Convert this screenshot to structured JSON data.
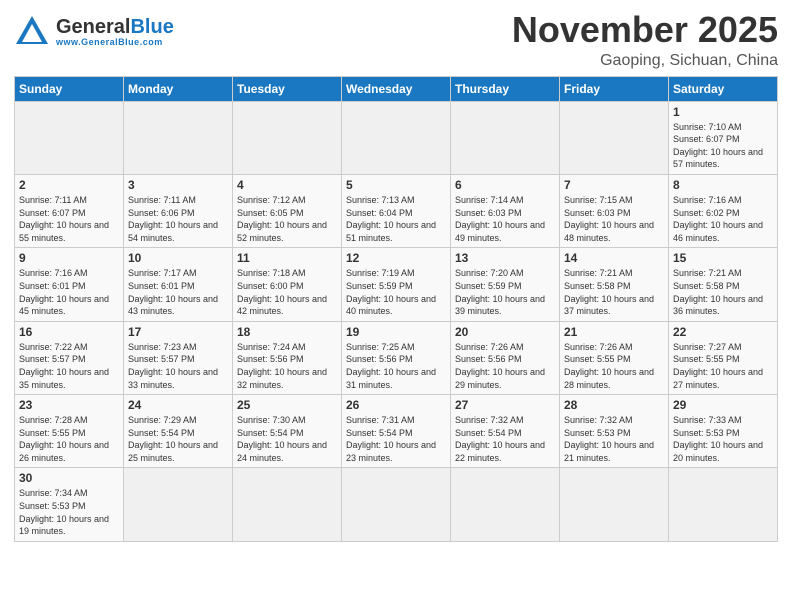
{
  "logo": {
    "word1": "General",
    "word2": "Blue"
  },
  "header": {
    "month": "November 2025",
    "location": "Gaoping, Sichuan, China"
  },
  "weekdays": [
    "Sunday",
    "Monday",
    "Tuesday",
    "Wednesday",
    "Thursday",
    "Friday",
    "Saturday"
  ],
  "weeks": [
    [
      {
        "day": "",
        "info": ""
      },
      {
        "day": "",
        "info": ""
      },
      {
        "day": "",
        "info": ""
      },
      {
        "day": "",
        "info": ""
      },
      {
        "day": "",
        "info": ""
      },
      {
        "day": "",
        "info": ""
      },
      {
        "day": "1",
        "info": "Sunrise: 7:10 AM\nSunset: 6:07 PM\nDaylight: 10 hours and 57 minutes."
      }
    ],
    [
      {
        "day": "2",
        "info": "Sunrise: 7:11 AM\nSunset: 6:07 PM\nDaylight: 10 hours and 55 minutes."
      },
      {
        "day": "3",
        "info": "Sunrise: 7:11 AM\nSunset: 6:06 PM\nDaylight: 10 hours and 54 minutes."
      },
      {
        "day": "4",
        "info": "Sunrise: 7:12 AM\nSunset: 6:05 PM\nDaylight: 10 hours and 52 minutes."
      },
      {
        "day": "5",
        "info": "Sunrise: 7:13 AM\nSunset: 6:04 PM\nDaylight: 10 hours and 51 minutes."
      },
      {
        "day": "6",
        "info": "Sunrise: 7:14 AM\nSunset: 6:03 PM\nDaylight: 10 hours and 49 minutes."
      },
      {
        "day": "7",
        "info": "Sunrise: 7:15 AM\nSunset: 6:03 PM\nDaylight: 10 hours and 48 minutes."
      },
      {
        "day": "8",
        "info": "Sunrise: 7:16 AM\nSunset: 6:02 PM\nDaylight: 10 hours and 46 minutes."
      }
    ],
    [
      {
        "day": "9",
        "info": "Sunrise: 7:16 AM\nSunset: 6:01 PM\nDaylight: 10 hours and 45 minutes."
      },
      {
        "day": "10",
        "info": "Sunrise: 7:17 AM\nSunset: 6:01 PM\nDaylight: 10 hours and 43 minutes."
      },
      {
        "day": "11",
        "info": "Sunrise: 7:18 AM\nSunset: 6:00 PM\nDaylight: 10 hours and 42 minutes."
      },
      {
        "day": "12",
        "info": "Sunrise: 7:19 AM\nSunset: 5:59 PM\nDaylight: 10 hours and 40 minutes."
      },
      {
        "day": "13",
        "info": "Sunrise: 7:20 AM\nSunset: 5:59 PM\nDaylight: 10 hours and 39 minutes."
      },
      {
        "day": "14",
        "info": "Sunrise: 7:21 AM\nSunset: 5:58 PM\nDaylight: 10 hours and 37 minutes."
      },
      {
        "day": "15",
        "info": "Sunrise: 7:21 AM\nSunset: 5:58 PM\nDaylight: 10 hours and 36 minutes."
      }
    ],
    [
      {
        "day": "16",
        "info": "Sunrise: 7:22 AM\nSunset: 5:57 PM\nDaylight: 10 hours and 35 minutes."
      },
      {
        "day": "17",
        "info": "Sunrise: 7:23 AM\nSunset: 5:57 PM\nDaylight: 10 hours and 33 minutes."
      },
      {
        "day": "18",
        "info": "Sunrise: 7:24 AM\nSunset: 5:56 PM\nDaylight: 10 hours and 32 minutes."
      },
      {
        "day": "19",
        "info": "Sunrise: 7:25 AM\nSunset: 5:56 PM\nDaylight: 10 hours and 31 minutes."
      },
      {
        "day": "20",
        "info": "Sunrise: 7:26 AM\nSunset: 5:56 PM\nDaylight: 10 hours and 29 minutes."
      },
      {
        "day": "21",
        "info": "Sunrise: 7:26 AM\nSunset: 5:55 PM\nDaylight: 10 hours and 28 minutes."
      },
      {
        "day": "22",
        "info": "Sunrise: 7:27 AM\nSunset: 5:55 PM\nDaylight: 10 hours and 27 minutes."
      }
    ],
    [
      {
        "day": "23",
        "info": "Sunrise: 7:28 AM\nSunset: 5:55 PM\nDaylight: 10 hours and 26 minutes."
      },
      {
        "day": "24",
        "info": "Sunrise: 7:29 AM\nSunset: 5:54 PM\nDaylight: 10 hours and 25 minutes."
      },
      {
        "day": "25",
        "info": "Sunrise: 7:30 AM\nSunset: 5:54 PM\nDaylight: 10 hours and 24 minutes."
      },
      {
        "day": "26",
        "info": "Sunrise: 7:31 AM\nSunset: 5:54 PM\nDaylight: 10 hours and 23 minutes."
      },
      {
        "day": "27",
        "info": "Sunrise: 7:32 AM\nSunset: 5:54 PM\nDaylight: 10 hours and 22 minutes."
      },
      {
        "day": "28",
        "info": "Sunrise: 7:32 AM\nSunset: 5:53 PM\nDaylight: 10 hours and 21 minutes."
      },
      {
        "day": "29",
        "info": "Sunrise: 7:33 AM\nSunset: 5:53 PM\nDaylight: 10 hours and 20 minutes."
      }
    ],
    [
      {
        "day": "30",
        "info": "Sunrise: 7:34 AM\nSunset: 5:53 PM\nDaylight: 10 hours and 19 minutes."
      },
      {
        "day": "",
        "info": ""
      },
      {
        "day": "",
        "info": ""
      },
      {
        "day": "",
        "info": ""
      },
      {
        "day": "",
        "info": ""
      },
      {
        "day": "",
        "info": ""
      },
      {
        "day": "",
        "info": ""
      }
    ]
  ]
}
